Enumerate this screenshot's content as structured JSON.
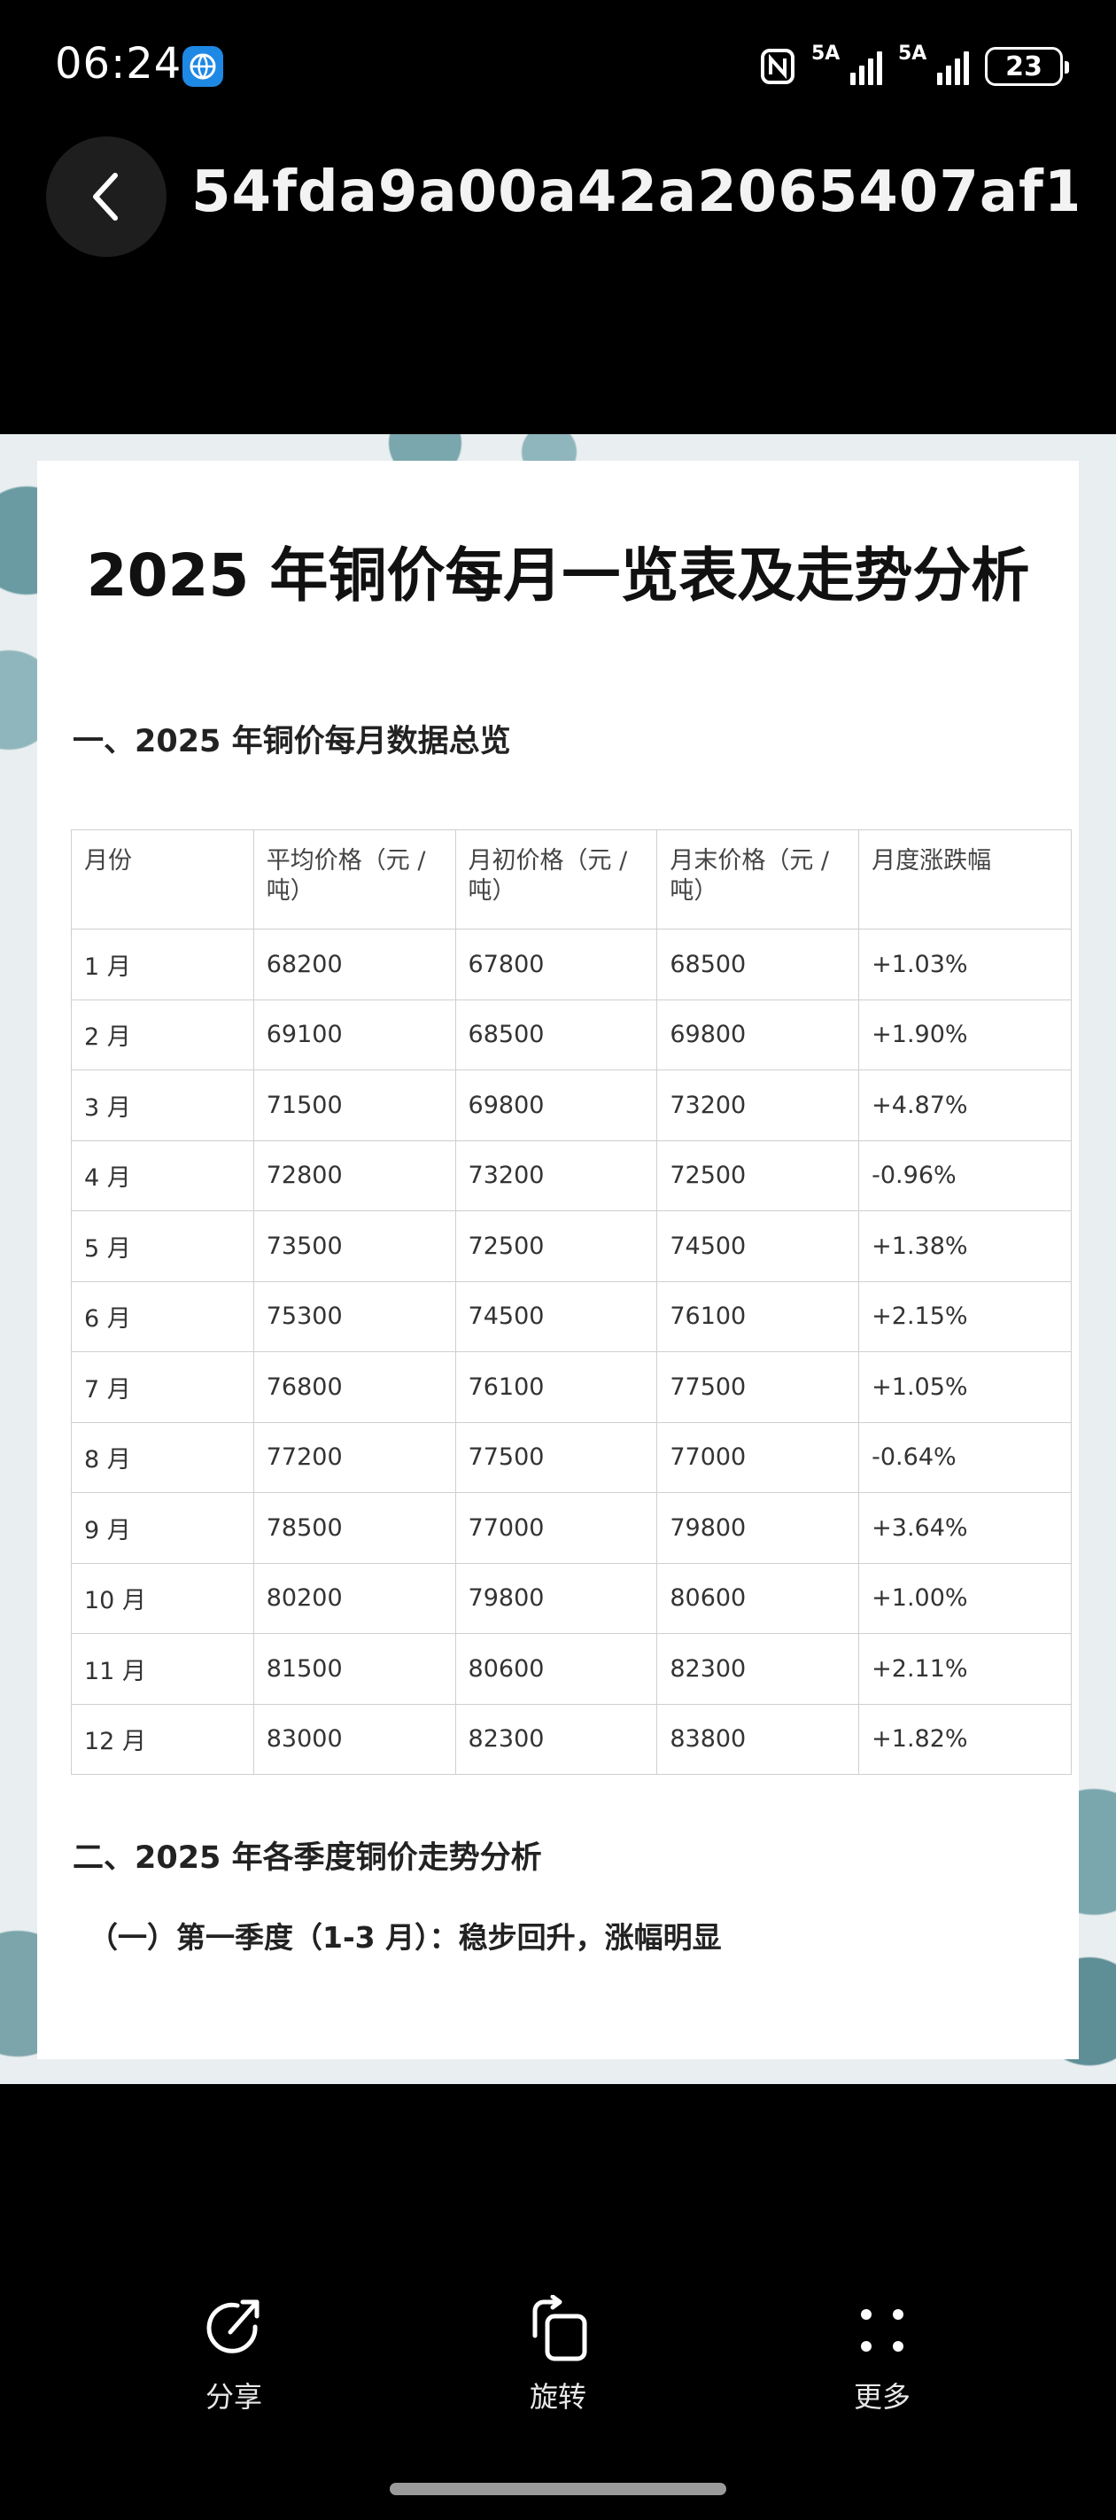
{
  "status_bar": {
    "time": "06:24",
    "signal1": "5A",
    "signal2": "5A",
    "battery": "23"
  },
  "header": {
    "title": "54fda9a00a42a2065407af1..."
  },
  "document": {
    "title": "2025 年铜价每月一览表及走势分析",
    "section1": "一、2025 年铜价每月数据总览",
    "table": {
      "headers": [
        "月份",
        "平均价格（元 / 吨）",
        "月初价格（元 / 吨）",
        "月末价格（元 / 吨）",
        "月度涨跌幅"
      ],
      "rows": [
        [
          "1 月",
          "68200",
          "67800",
          "68500",
          "+1.03%"
        ],
        [
          "2 月",
          "69100",
          "68500",
          "69800",
          "+1.90%"
        ],
        [
          "3 月",
          "71500",
          "69800",
          "73200",
          "+4.87%"
        ],
        [
          "4 月",
          "72800",
          "73200",
          "72500",
          "-0.96%"
        ],
        [
          "5 月",
          "73500",
          "72500",
          "74500",
          "+1.38%"
        ],
        [
          "6 月",
          "75300",
          "74500",
          "76100",
          "+2.15%"
        ],
        [
          "7 月",
          "76800",
          "76100",
          "77500",
          "+1.05%"
        ],
        [
          "8 月",
          "77200",
          "77500",
          "77000",
          "-0.64%"
        ],
        [
          "9 月",
          "78500",
          "77000",
          "79800",
          "+3.64%"
        ],
        [
          "10 月",
          "80200",
          "79800",
          "80600",
          "+1.00%"
        ],
        [
          "11 月",
          "81500",
          "80600",
          "82300",
          "+2.11%"
        ],
        [
          "12 月",
          "83000",
          "82300",
          "83800",
          "+1.82%"
        ]
      ]
    },
    "section2": "二、2025 年各季度铜价走势分析",
    "subsection": "（一）第一季度（1-3 月）：稳步回升，涨幅明显"
  },
  "actions": [
    {
      "label": "分享",
      "icon": "share-icon"
    },
    {
      "label": "旋转",
      "icon": "rotate-icon"
    },
    {
      "label": "更多",
      "icon": "more-icon"
    }
  ]
}
